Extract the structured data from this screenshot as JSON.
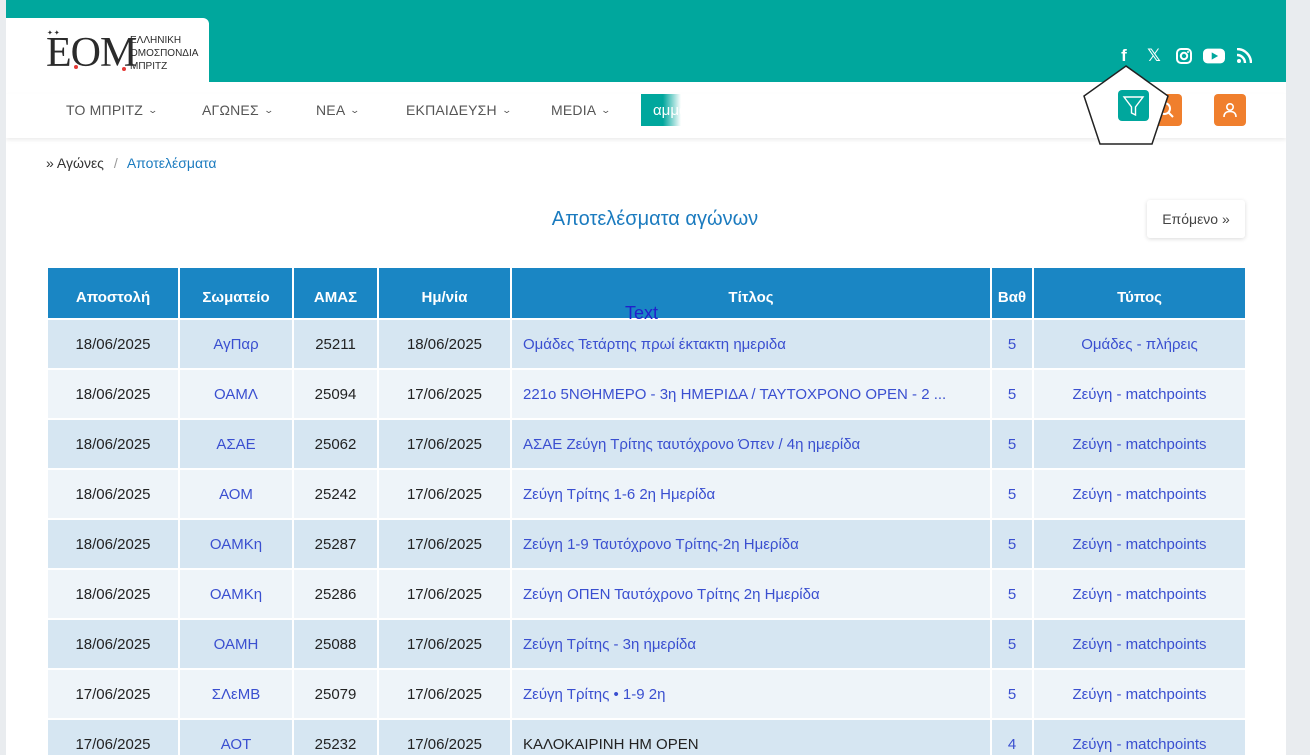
{
  "logo": {
    "mark": "EOM",
    "text": "ΕΛΛΗΝΙΚΗ ΟΜΟΣΠΟΝΔΙΑ ΜΠΡΙΤΖ"
  },
  "social": [
    {
      "icon": "facebook-icon",
      "glyph": "f"
    },
    {
      "icon": "x-icon",
      "glyph": "𝕏"
    },
    {
      "icon": "instagram-icon",
      "glyph": "◎"
    },
    {
      "icon": "youtube-icon",
      "glyph": "▶"
    },
    {
      "icon": "rss-icon",
      "glyph": "◟"
    }
  ],
  "nav": {
    "items": [
      {
        "label": "ΤΟ ΜΠΡΙΤΖ"
      },
      {
        "label": "ΑΓΩΝΕΣ"
      },
      {
        "label": "ΝΕΑ"
      },
      {
        "label": "ΕΚΠΑΙΔΕΥΣΗ"
      },
      {
        "label": "MEDIA"
      }
    ],
    "search_partial": "αμμα"
  },
  "breadcrumb": {
    "prefix": "»",
    "parent": "Αγώνες",
    "separator": "/",
    "current": "Αποτελέσματα"
  },
  "page_title": "Αποτελέσματα αγώνων",
  "next_button": "Επόμενο »",
  "overlay_text": "Text",
  "colors": {
    "brand": "#00a79d",
    "accent": "#f07f2d",
    "header": "#1a86c4",
    "link": "#3a4fd0"
  },
  "table": {
    "headers": [
      "Αποστολή",
      "Σωματείο",
      "ΑΜΑΣ",
      "Ημ/νία",
      "Τίτλος",
      "Βαθ",
      "Τύπος"
    ],
    "rows": [
      {
        "sent": "18/06/2025",
        "club": "ΑγΠαρ",
        "amas": "25211",
        "date": "18/06/2025",
        "title": "Ομάδες Τετάρτης πρωί έκτακτη ημεριδα",
        "title_link": true,
        "level": "5",
        "type": "Ομάδες - πλήρεις"
      },
      {
        "sent": "18/06/2025",
        "club": "ΟΑΜΛ",
        "amas": "25094",
        "date": "17/06/2025",
        "title": "221ο 5ΝΘΗΜΕΡΟ - 3η ΗΜΕΡΙΔΑ / ΤΑΥΤΟΧΡΟΝΟ OPEN - 2 ...",
        "title_link": true,
        "level": "5",
        "type": "Ζεύγη - matchpoints"
      },
      {
        "sent": "18/06/2025",
        "club": "ΑΣΑΕ",
        "amas": "25062",
        "date": "17/06/2025",
        "title": "ΑΣΑΕ Ζεύγη Τρίτης ταυτόχρονο Όπεν / 4η ημερίδα",
        "title_link": true,
        "level": "5",
        "type": "Ζεύγη - matchpoints"
      },
      {
        "sent": "18/06/2025",
        "club": "ΑΟΜ",
        "amas": "25242",
        "date": "17/06/2025",
        "title": "Ζεύγη Τρίτης 1-6 2η Ημερίδα",
        "title_link": true,
        "level": "5",
        "type": "Ζεύγη - matchpoints"
      },
      {
        "sent": "18/06/2025",
        "club": "ΟΑΜΚη",
        "amas": "25287",
        "date": "17/06/2025",
        "title": "Ζεύγη 1-9 Ταυτόχρονο Τρίτης-2η Ημερίδα",
        "title_link": true,
        "level": "5",
        "type": "Ζεύγη - matchpoints"
      },
      {
        "sent": "18/06/2025",
        "club": "ΟΑΜΚη",
        "amas": "25286",
        "date": "17/06/2025",
        "title": "Ζεύγη ΟΠΕΝ Ταυτόχρονο Τρίτης 2η Ημερίδα",
        "title_link": true,
        "level": "5",
        "type": "Ζεύγη - matchpoints"
      },
      {
        "sent": "18/06/2025",
        "club": "ΟΑΜΗ",
        "amas": "25088",
        "date": "17/06/2025",
        "title": "Ζεύγη Τρίτης - 3η ημερίδα",
        "title_link": true,
        "level": "5",
        "type": "Ζεύγη - matchpoints"
      },
      {
        "sent": "17/06/2025",
        "club": "ΣΛεΜΒ",
        "amas": "25079",
        "date": "17/06/2025",
        "title": "Ζεύγη Τρίτης • 1-9 2η",
        "title_link": true,
        "level": "5",
        "type": "Ζεύγη - matchpoints"
      },
      {
        "sent": "17/06/2025",
        "club": "ΑΟΤ",
        "amas": "25232",
        "date": "17/06/2025",
        "title": "ΚΑΛΟΚΑΙΡΙΝΗ ΗΜ OPEN",
        "title_link": false,
        "level": "4",
        "type": "Ζεύγη - matchpoints"
      }
    ]
  }
}
